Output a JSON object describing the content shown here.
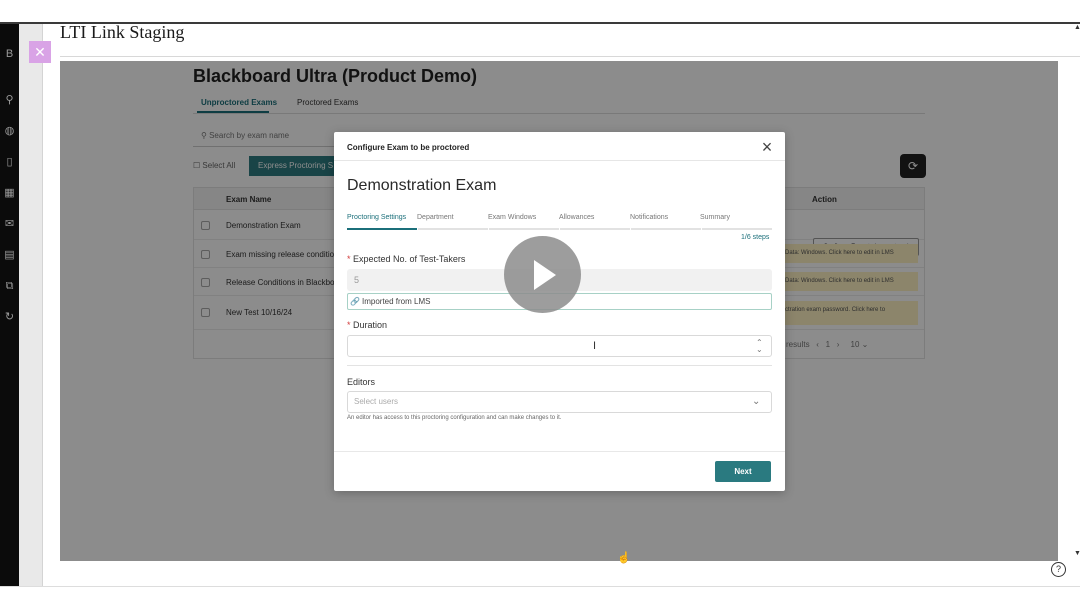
{
  "window": {
    "title": "LTI Link Staging"
  },
  "background_page": {
    "course_title": "Blackboard Ultra (Product Demo)",
    "tabs": [
      {
        "label": "Unproctored Exams",
        "active": true
      },
      {
        "label": "Proctored Exams",
        "active": false
      }
    ],
    "search_placeholder": "Search by exam name",
    "select_all_label": "Select All",
    "express_button_label": "Express Proctoring S",
    "table": {
      "headers": [
        "Exam Name",
        "Action"
      ],
      "rows": [
        {
          "name": "Demonstration Exam",
          "action": "Configure Exam to be proctored"
        },
        {
          "name": "Exam missing release conditio",
          "action": "Data: Windows. Click here to edit in LMS"
        },
        {
          "name": "Release Conditions in Blackbo",
          "action": "Data: Windows. Click here to edit in LMS"
        },
        {
          "name": "New Test 10/16/24",
          "action": "ctration exam password. Click here to"
        }
      ],
      "pager": {
        "results_text": "results",
        "page": "1",
        "page_size": "10"
      }
    }
  },
  "modal": {
    "header_title": "Configure Exam to be proctored",
    "exam_title": "Demonstration Exam",
    "steps": [
      "Proctoring Settings",
      "Department",
      "Exam Windows",
      "Allowances",
      "Notifications",
      "Summary"
    ],
    "step_counter": "1/6 steps",
    "expected_takers": {
      "label": "Expected No. of Test-Takers",
      "value": "5",
      "hint": "Imported from LMS"
    },
    "duration": {
      "label": "Duration",
      "value": ""
    },
    "editors": {
      "label": "Editors",
      "placeholder": "Select users",
      "help": "An editor has access to this proctoring configuration and can make changes to it."
    },
    "next_label": "Next"
  },
  "icons": {
    "close_chip": "close-icon",
    "modal_close": "close-icon",
    "play": "play-icon",
    "help": "help-icon",
    "refresh": "refresh-icon"
  },
  "colors": {
    "accent": "#2a7a80",
    "close_chip": "#d9a3e6",
    "left_rail": "#0b0b0b"
  }
}
